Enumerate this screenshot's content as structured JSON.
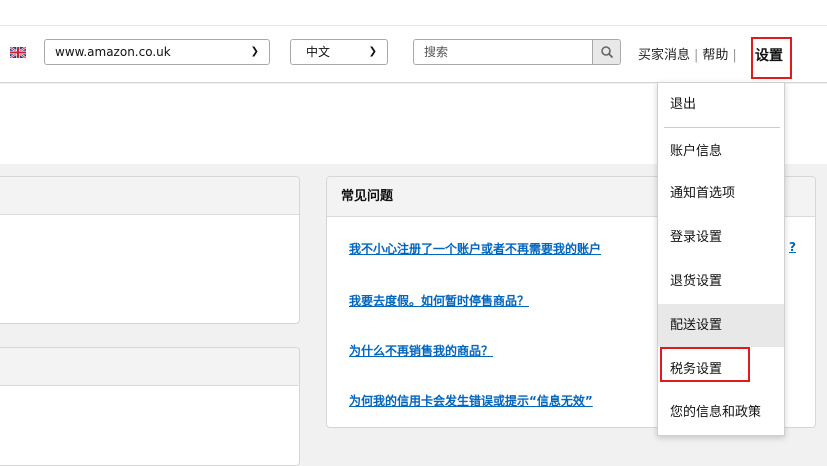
{
  "header": {
    "flag_icon": "uk-flag-icon",
    "site_select": {
      "value": "www.amazon.co.uk"
    },
    "language_select": {
      "value": "中文"
    },
    "search": {
      "placeholder": "搜索",
      "icon": "magnifier-icon"
    },
    "links": {
      "buyer_messages": "买家消息",
      "help": "帮助",
      "settings": "设置"
    }
  },
  "faq": {
    "title": "常见问题",
    "questions": [
      "我不小心注册了一个账户或者不再需要我的账户",
      "我要去度假。如何暂时停售商品？",
      "为什么不再销售我的商品？",
      "为何我的信用卡会发生错误或提示“信息无效”"
    ],
    "overflow_tail": "?"
  },
  "settings_menu": {
    "items": [
      "退出",
      "账户信息",
      "通知首选项",
      "登录设置",
      "退货设置",
      "配送设置",
      "税务设置",
      "您的信息和政策"
    ],
    "highlighted_index": 5,
    "boxed_index": 6
  },
  "colors": {
    "link": "#0066c0",
    "highlight_box": "#e31a1a"
  }
}
